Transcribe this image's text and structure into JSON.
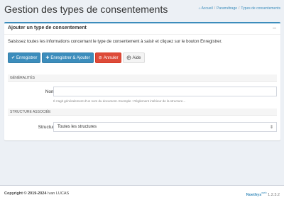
{
  "header": {
    "title": "Gestion des types de consentements",
    "breadcrumb": [
      "Accueil",
      "Paramétrage",
      "Types de consentements"
    ]
  },
  "box": {
    "title": "Ajouter un type de consentement",
    "collapse_symbol": "–"
  },
  "intro_text": "Saisissez toutes les informations concernant le type de consentement à saisir et cliquez sur le bouton Enregistrer.",
  "buttons": {
    "save": "Enregistrer",
    "save_add": "Enregistrer & Ajouter",
    "cancel": "Annuler",
    "help": "Aide"
  },
  "sections": {
    "general": "GÉNÉRALITÉS",
    "structure": "STRUCTURE ASSOCIÉE"
  },
  "form": {
    "nom_label": "Nom*",
    "nom_value": "",
    "nom_help": "Il s'agit généralement d'un nom du document. Exemple : Règlement intérieur de la structure...",
    "structure_label": "Structure",
    "structure_selected": "Toutes les structures"
  },
  "footer": {
    "copyright_label": "Copyright © 2019-2024",
    "copyright_owner": "Ivan LUCAS",
    "brand": "Noethys",
    "brand_sup": "web",
    "version": "1.2.3.2"
  },
  "colors": {
    "primary": "#3c8dbc",
    "danger": "#dd4b39",
    "background": "#ecf0f5"
  },
  "icons": {
    "home": "home-icon",
    "save": "check-icon",
    "save_add": "plus-icon",
    "cancel": "ban-icon",
    "help": "help-circle-icon",
    "select_caret": "updown-caret-icon"
  }
}
